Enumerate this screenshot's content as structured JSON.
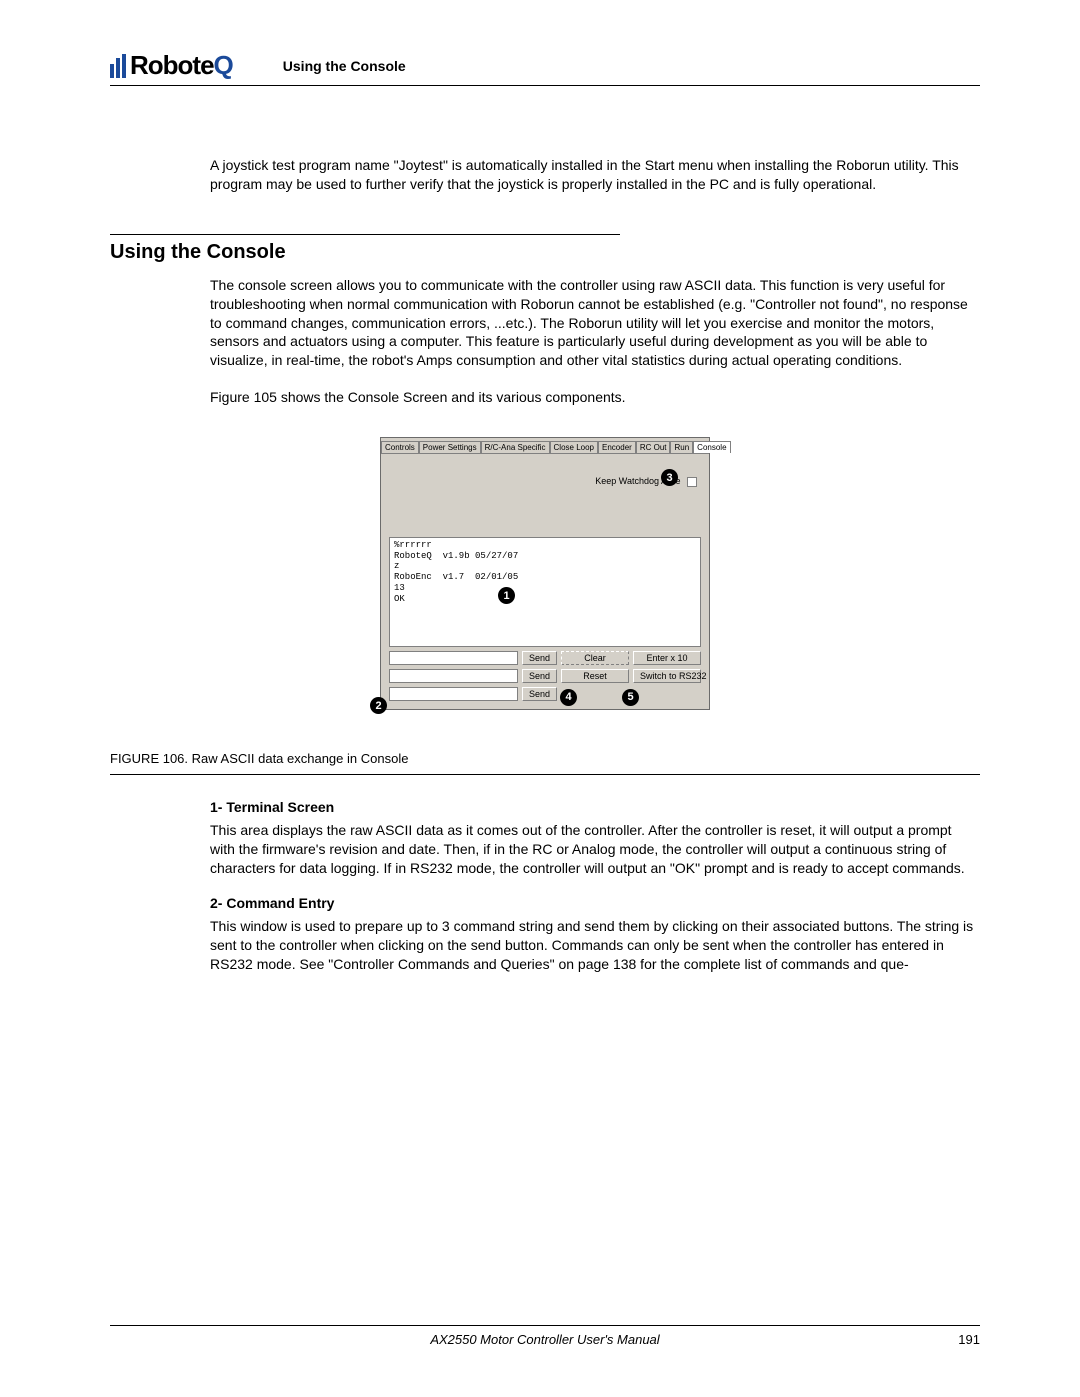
{
  "brand": {
    "name_prefix": "Robote",
    "name_suffix": "Q"
  },
  "header": {
    "title": "Using the Console"
  },
  "intro": "A joystick test program name \"Joytest\" is automatically installed in the Start menu when installing the Roborun utility. This program may be used to further verify that the joystick is properly installed in the PC and is fully operational.",
  "section": {
    "heading": "Using the Console",
    "p1": "The console screen allows you to communicate with the controller using raw ASCII data. This function is very useful for troubleshooting when normal communication with Roborun cannot be established (e.g. \"Controller not found\", no response to command changes, communication errors, ...etc.). The Roborun utility will let you exercise and monitor the motors, sensors and actuators using a computer. This feature is particularly useful during development as you will be able to visualize, in real-time, the robot's Amps consumption and other vital statistics during actual operating conditions.",
    "p2": "Figure 105 shows the Console Screen and its various components."
  },
  "console_window": {
    "tabs": [
      "Controls",
      "Power Settings",
      "R/C-Ana Specific",
      "Close Loop",
      "Encoder",
      "RC Out",
      "Run",
      "Console"
    ],
    "active_tab_index": 7,
    "watchdog_label": "Keep Watchdog Alive",
    "terminal_text": "%rrrrrr\nRoboteQ  v1.9b 05/27/07\nz\nRoboEnc  v1.7  02/01/05\n13\nOK",
    "buttons": {
      "send": "Send",
      "clear": "Clear",
      "reset": "Reset",
      "enter_x10": "Enter x 10",
      "switch_rs232": "Switch to RS232"
    },
    "callouts": {
      "c1": "1",
      "c2": "2",
      "c3": "3",
      "c4": "4",
      "c5": "5"
    }
  },
  "figure_caption": "FIGURE 106.  Raw ASCII data exchange in Console",
  "sub1": {
    "heading": "1- Terminal Screen",
    "text": "This area displays the raw ASCII data as it comes out of the controller. After the controller is reset, it will output a prompt with the firmware's revision and date. Then, if in the RC or Analog mode, the controller will output a continuous string of characters for data logging. If in RS232 mode, the controller will output an \"OK\" prompt and is ready to accept commands."
  },
  "sub2": {
    "heading": "2- Command Entry",
    "text": "This window is used to prepare up to 3 command string and send them by clicking on their associated buttons. The string is sent to the controller when clicking on the send button. Commands can only be sent when the controller has entered in RS232 mode. See \"Controller Commands and Queries\" on page 138 for the complete list of commands and que-"
  },
  "footer": {
    "manual": "AX2550 Motor Controller User's Manual",
    "page": "191"
  }
}
